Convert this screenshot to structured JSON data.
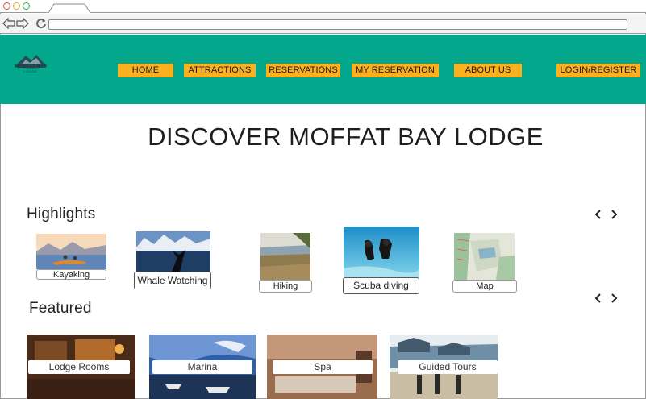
{
  "site": {
    "logo_text": "MOFFAT BAY",
    "logo_subtext": "LODGE"
  },
  "nav": {
    "home": "HOME",
    "attractions": "ATTRACTIONS",
    "reservations": "RESERVATIONS",
    "my_reservation": "MY RESERVATION",
    "about_us": "ABOUT US",
    "login_register": "LOGIN/REGISTER"
  },
  "main": {
    "title": "DISCOVER MOFFAT BAY LODGE",
    "highlights": {
      "heading": "Highlights",
      "items": [
        {
          "label": "Kayaking"
        },
        {
          "label": "Whale Watching"
        },
        {
          "label": "Hiking"
        },
        {
          "label": "Scuba diving"
        },
        {
          "label": "Map"
        }
      ]
    },
    "featured": {
      "heading": "Featured",
      "items": [
        {
          "label": "Lodge Rooms"
        },
        {
          "label": "Marina"
        },
        {
          "label": "Spa"
        },
        {
          "label": "Guided Tours"
        }
      ]
    }
  },
  "colors": {
    "header_bg": "#03a88c",
    "nav_button": "#fbb020"
  }
}
